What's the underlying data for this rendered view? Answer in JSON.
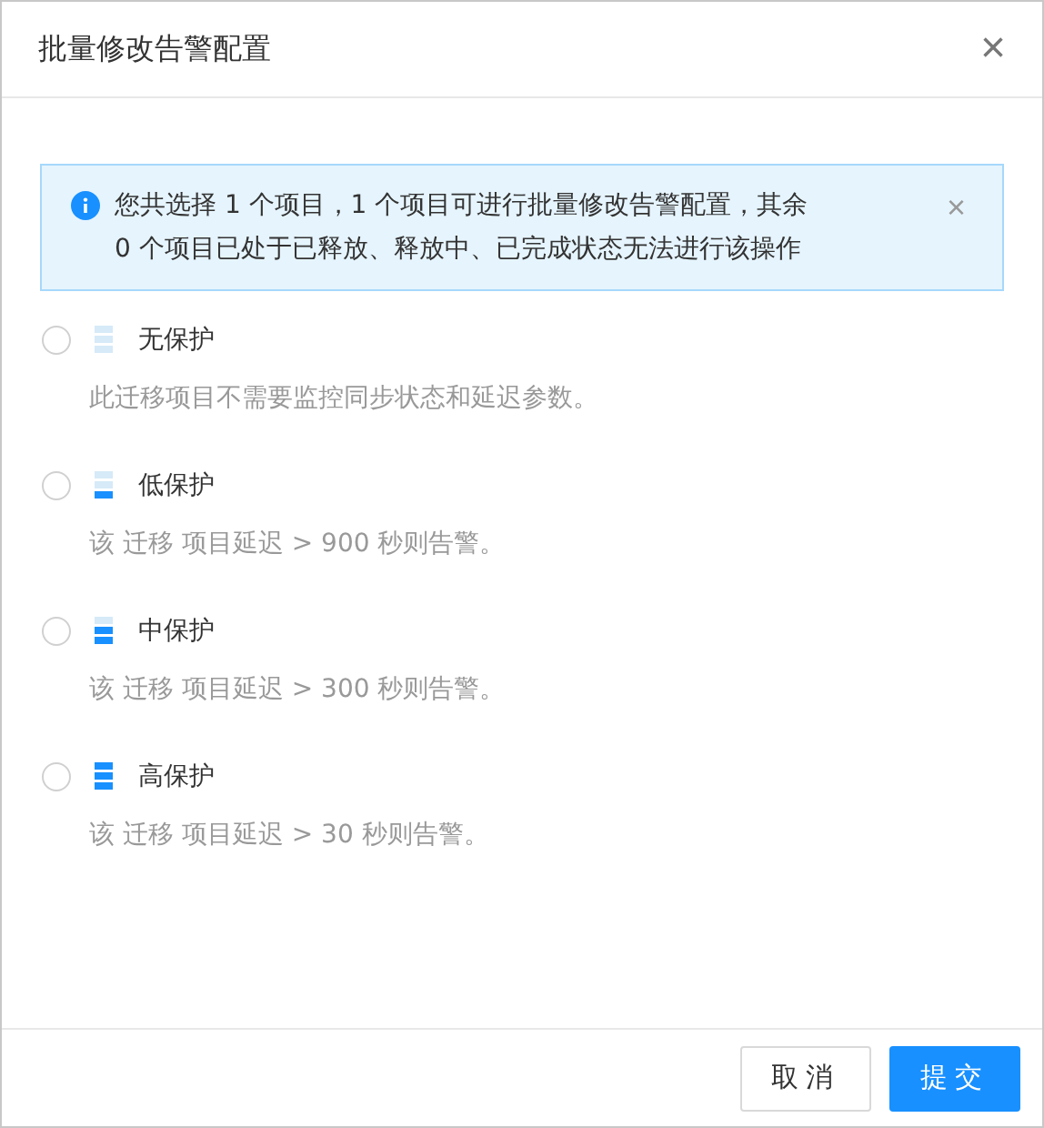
{
  "dialog": {
    "title": "批量修改告警配置",
    "close": "×"
  },
  "alert": {
    "text": "您共选择 1 个项目，1 个项目可进行批量修改告警配置，其余 0 个项目已处于已释放、释放中、已完成状态无法进行该操作",
    "close": "×"
  },
  "options": [
    {
      "label": "无保护",
      "description": "此迁移项目不需要监控同步状态和延迟参数。",
      "kind": "none",
      "selected": false
    },
    {
      "label": "低保护",
      "description": "该 迁移 项目延迟 > 900 秒则告警。",
      "kind": "low",
      "selected": false
    },
    {
      "label": "中保护",
      "description": "该 迁移 项目延迟 > 300 秒则告警。",
      "kind": "medium",
      "selected": false
    },
    {
      "label": "高保护",
      "description": "该 迁移 项目延迟 > 30 秒则告警。",
      "kind": "high",
      "selected": false
    }
  ],
  "buttons": [
    {
      "label": "取消",
      "kind": "secondary"
    },
    {
      "label": "提交",
      "kind": "primary"
    }
  ]
}
